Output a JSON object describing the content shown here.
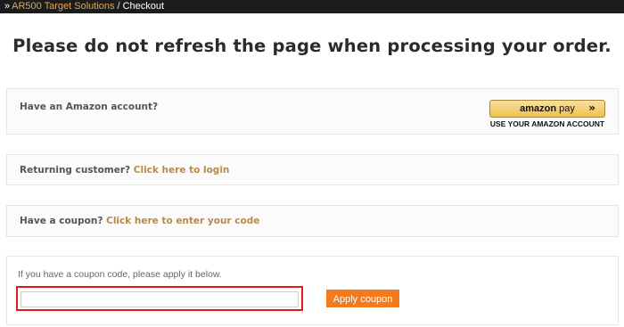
{
  "breadcrumb": {
    "separator_icon": "»",
    "home_label": "AR500 Target Solutions",
    "divider": "/",
    "current": "Checkout"
  },
  "notice": "Please do not refresh the page when processing your order.",
  "amazon": {
    "prompt": "Have an Amazon account?",
    "button_brand": "amazon",
    "button_pay": "pay",
    "button_icon": "chevron-double-right",
    "caption": "USE YOUR AMAZON ACCOUNT"
  },
  "login": {
    "prompt": "Returning customer?",
    "link": "Click here to login"
  },
  "coupon_toggle": {
    "prompt": "Have a coupon?",
    "link": "Click here to enter your code"
  },
  "coupon_form": {
    "hint": "If you have a coupon code, please apply it below.",
    "input_value": "",
    "apply_label": "Apply coupon"
  },
  "colors": {
    "accent_link": "#b78a4b",
    "apply_button": "#f47a1f",
    "highlight_border": "#e21b1b"
  }
}
